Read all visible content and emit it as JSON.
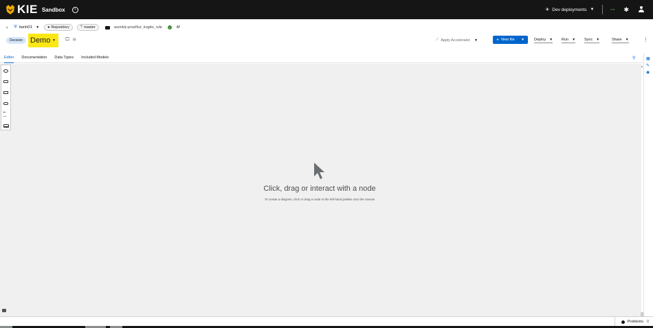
{
  "header": {
    "logo_text": "KIE",
    "sandbox_label": "Sandbox",
    "info_icon": "i",
    "dev_deployments": "Dev deployments",
    "connection_icon": "⊶",
    "gear_icon": "✱"
  },
  "breadcrumb": {
    "back_icon": "‹",
    "account": "ttanhD1",
    "repository": "Repository",
    "branch": "master",
    "path": "asonkiy-prod/luz_kogito_rule",
    "modified": "M"
  },
  "toolbar": {
    "file_type": "Decision",
    "file_name": "Demo",
    "apply_accelerator": "Apply Accelerator",
    "new_file": "New file",
    "deploy": "Deploy",
    "run": "Run",
    "sync": "Sync",
    "share": "Share",
    "kebab": "⋮"
  },
  "tabs": [
    {
      "label": "Editor"
    },
    {
      "label": "Documentation"
    },
    {
      "label": "Data Types"
    },
    {
      "label": "Included Models"
    }
  ],
  "canvas": {
    "empty_title": "Click, drag or interact with a node",
    "empty_subtitle": "To create a diagram, click or drag a node in the left-hand palette onto the canvas"
  },
  "status": {
    "problems_label": "Problems",
    "problems_count": "0"
  },
  "colors": {
    "header_bg": "#151515",
    "accent": "#0066cc",
    "filename_highlight": "#fbe715",
    "canvas_bg": "#f0f0f0",
    "success": "#3e8635"
  }
}
